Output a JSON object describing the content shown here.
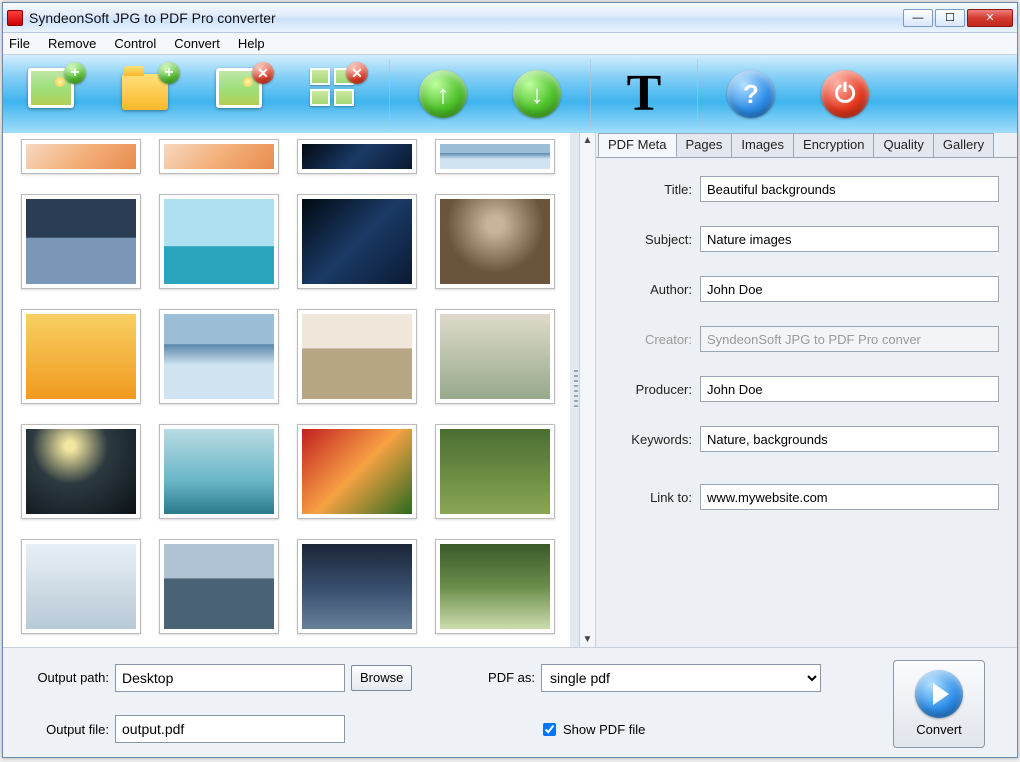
{
  "window": {
    "title": "SyndeonSoft JPG to PDF Pro converter"
  },
  "menu": {
    "file": "File",
    "remove": "Remove",
    "control": "Control",
    "convert": "Convert",
    "help": "Help"
  },
  "toolbar_icons": {
    "add_image": "add-image-icon",
    "add_folder": "add-folder-icon",
    "remove_image": "remove-image-icon",
    "remove_all": "remove-all-icon",
    "move_up": "move-up-icon",
    "move_down": "move-down-icon",
    "text": "text-icon",
    "help": "help-icon",
    "exit": "power-icon"
  },
  "tabs": {
    "pdf_meta": "PDF Meta",
    "pages": "Pages",
    "images": "Images",
    "encryption": "Encryption",
    "quality": "Quality",
    "gallery": "Gallery"
  },
  "meta": {
    "title_label": "Title:",
    "title_value": "Beautiful backgrounds",
    "subject_label": "Subject:",
    "subject_value": "Nature images",
    "author_label": "Author:",
    "author_value": "John Doe",
    "creator_label": "Creator:",
    "creator_value": "SyndeonSoft JPG to PDF Pro conver",
    "producer_label": "Producer:",
    "producer_value": "John Doe",
    "keywords_label": "Keywords:",
    "keywords_value": "Nature, backgrounds",
    "link_label": "Link to:",
    "link_value": "www.mywebsite.com"
  },
  "output": {
    "path_label": "Output path:",
    "path_value": "Desktop",
    "browse": "Browse",
    "file_label": "Output file:",
    "file_value": "output.pdf",
    "pdf_as_label": "PDF as:",
    "pdf_as_value": "single pdf",
    "show_pdf_label": "Show PDF file",
    "show_pdf_checked": true,
    "convert": "Convert"
  }
}
